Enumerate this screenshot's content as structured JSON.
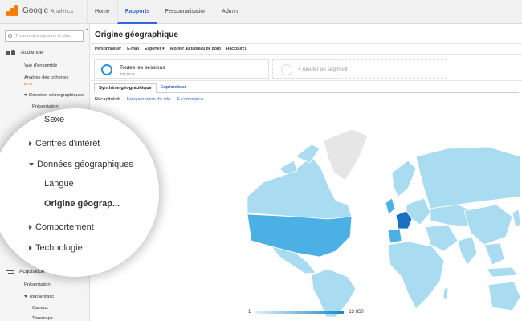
{
  "app": {
    "logo_text": "Google",
    "logo_sub": "Analytics"
  },
  "nav": {
    "items": [
      "Home",
      "Rapports",
      "Personnalisation",
      "Admin"
    ],
    "active": "Rapports"
  },
  "sidebar": {
    "search_placeholder": "Trouver des rapports et plus",
    "audience_label": "Audience",
    "vue_ensemble": "Vue d'ensemble",
    "analyse_cohortes": "Analyse des cohortes",
    "beta": "BETA",
    "donnees_demo": "Données démographiques",
    "presentation": "Présentation",
    "acquisition_label": "Acquisition",
    "acq_presentation": "Présentation",
    "tout_trafic": "Tout le trafic",
    "canaux": "Canaux",
    "treemaps": "Treemaps"
  },
  "content": {
    "title": "Origine géographique",
    "toolbar": [
      "Personnaliser",
      "E-mail",
      "Exporter ▾",
      "Ajouter au tableau de bord",
      "Raccourci"
    ],
    "segment1": {
      "name": "Toutes les sessions",
      "pct": "100,00 %"
    },
    "segment2": {
      "name": "+ Ajouter un segment"
    },
    "tabs": [
      "Synthèse géographique",
      "Explorateur"
    ],
    "subtabs": [
      "Récapitulatif",
      "Fréquentation du site",
      "E-commerce"
    ]
  },
  "legend": {
    "min": "1",
    "max": "13 850"
  },
  "magnifier": {
    "sexe": "Sexe",
    "centres": "Centres d'intérêt",
    "geo": "Données géographiques",
    "langue": "Langue",
    "origine": "Origine géograp...",
    "comportement": "Comportement",
    "technologie": "Technologie"
  },
  "colors": {
    "accent": "#3367d6",
    "map_base": "#a9dcf0",
    "map_dark": "#2b8fd6",
    "map_grey": "#e6e6e6",
    "france": "#1a6fc2"
  }
}
